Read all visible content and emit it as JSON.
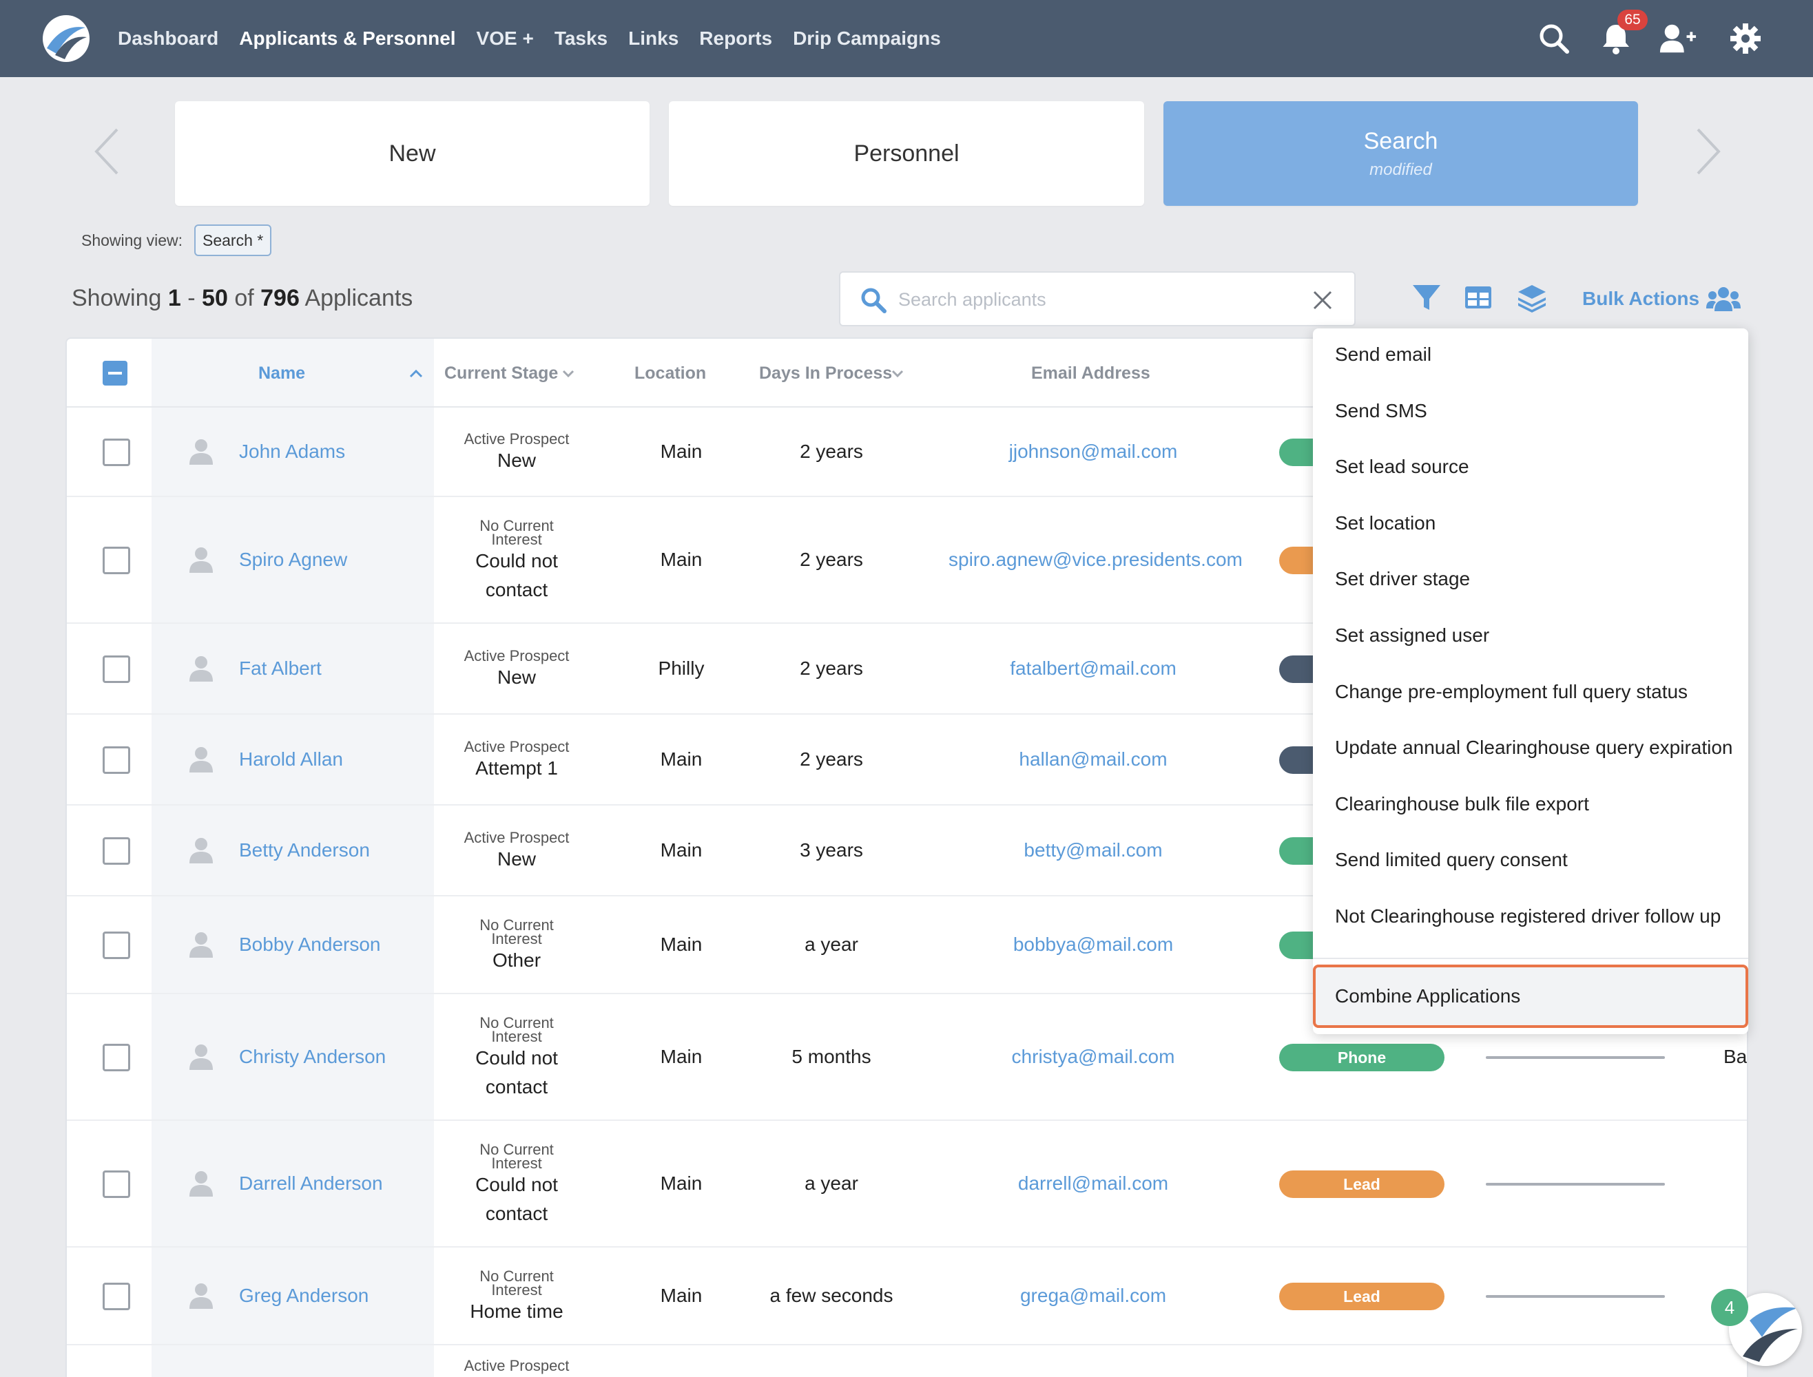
{
  "nav": {
    "links": [
      "Dashboard",
      "Applicants & Personnel",
      "VOE +",
      "Tasks",
      "Links",
      "Reports",
      "Drip Campaigns"
    ],
    "active_index": 1,
    "notification_count": "65"
  },
  "tiles": [
    {
      "label": "New",
      "sub": ""
    },
    {
      "label": "Personnel",
      "sub": ""
    },
    {
      "label": "Search",
      "sub": "modified"
    }
  ],
  "view": {
    "label": "Showing view:",
    "chip": "Search *"
  },
  "count": {
    "prefix": "Showing",
    "from": "1",
    "sep": "-",
    "to": "50",
    "of": "of",
    "total": "796",
    "noun": "Applicants"
  },
  "search": {
    "placeholder": "Search applicants",
    "value": ""
  },
  "bulk_actions_label": "Bulk Actions",
  "table": {
    "headers": [
      "Name",
      "Current Stage",
      "Location",
      "Days In Process",
      "Email Address"
    ],
    "rows": [
      {
        "name": "John Adams",
        "stage_top": "Active Prospect",
        "stage": "New",
        "location": "Main",
        "days": "2 years",
        "email": "jjohnson@mail.com",
        "pill": "",
        "pill_color": "#4fb283"
      },
      {
        "name": "Spiro Agnew",
        "stage_top": "No Current Interest",
        "stage": "Could not contact",
        "location": "Main",
        "days": "2 years",
        "email": "spiro.agnew@vice.presidents.com",
        "pill": "",
        "pill_color": "#ea9a4f"
      },
      {
        "name": "Fat Albert",
        "stage_top": "Active Prospect",
        "stage": "New",
        "location": "Philly",
        "days": "2 years",
        "email": "fatalbert@mail.com",
        "pill": "",
        "pill_color": "#4b5b6f"
      },
      {
        "name": "Harold Allan",
        "stage_top": "Active Prospect",
        "stage": "Attempt 1",
        "location": "Main",
        "days": "2 years",
        "email": "hallan@mail.com",
        "pill": "",
        "pill_color": "#4b5b6f"
      },
      {
        "name": "Betty Anderson",
        "stage_top": "Active Prospect",
        "stage": "New",
        "location": "Main",
        "days": "3 years",
        "email": "betty@mail.com",
        "pill": "",
        "pill_color": "#4fb283"
      },
      {
        "name": "Bobby Anderson",
        "stage_top": "No Current Interest",
        "stage": "Other",
        "location": "Main",
        "days": "a year",
        "email": "bobbya@mail.com",
        "pill": "",
        "pill_color": "#4fb283"
      },
      {
        "name": "Christy Anderson",
        "stage_top": "No Current Interest",
        "stage": "Could not contact",
        "location": "Main",
        "days": "5 months",
        "email": "christya@mail.com",
        "pill": "Phone",
        "pill_color": "#4fb283",
        "extra": "Ba"
      },
      {
        "name": "Darrell Anderson",
        "stage_top": "No Current Interest",
        "stage": "Could not contact",
        "location": "Main",
        "days": "a year",
        "email": "darrell@mail.com",
        "pill": "Lead",
        "pill_color": "#ea9a4f"
      },
      {
        "name": "Greg Anderson",
        "stage_top": "No Current Interest",
        "stage": "Home time",
        "location": "Main",
        "days": "a few seconds",
        "email": "grega@mail.com",
        "pill": "Lead",
        "pill_color": "#ea9a4f"
      },
      {
        "name": "",
        "stage_top": "Active Prospect",
        "stage": "",
        "location": "",
        "days": "",
        "email": "",
        "pill": "",
        "pill_color": ""
      }
    ]
  },
  "bulk_menu": {
    "items": [
      "Send email",
      "Send SMS",
      "Set lead source",
      "Set location",
      "Set driver stage",
      "Set assigned user",
      "Change pre-employment full query status",
      "Update annual Clearinghouse query expiration",
      "Clearinghouse bulk file export",
      "Send limited query consent",
      "Not Clearinghouse registered driver follow up"
    ],
    "highlighted": "Combine Applications"
  },
  "chat_badge": "4",
  "colors": {
    "nav_bg": "#4b5b6f",
    "accent_blue": "#5b9ad8",
    "active_tile": "#7eaee2",
    "green": "#4fb283",
    "orange": "#ea9a4f",
    "highlight_border": "#e97548"
  },
  "icons": [
    "logo-icon",
    "search-icon",
    "bell-icon",
    "add-user-icon",
    "gear-icon",
    "chevron-left-icon",
    "chevron-right-icon",
    "filter-icon",
    "table-icon",
    "layers-icon",
    "users-icon",
    "close-icon",
    "person-icon",
    "sort-up-icon",
    "sort-down-icon"
  ]
}
